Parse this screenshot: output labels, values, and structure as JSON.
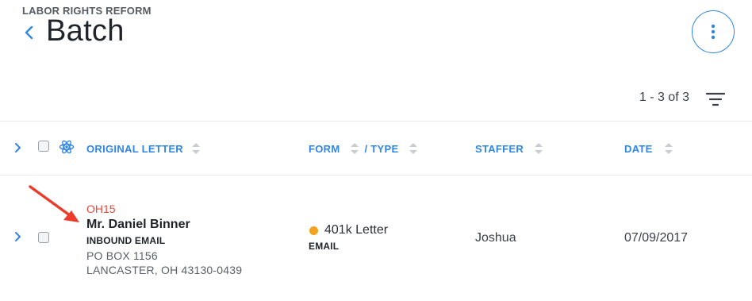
{
  "header": {
    "eyebrow": "LABOR RIGHTS REFORM",
    "title": "Batch"
  },
  "pager": {
    "range": "1 - 3 of 3"
  },
  "columns": {
    "original_letter": "ORIGINAL LETTER",
    "form": "FORM",
    "type": "/ TYPE",
    "staffer": "STAFFER",
    "date": "DATE"
  },
  "rows": [
    {
      "code": "OH15",
      "name": "Mr. Daniel Binner",
      "method": "INBOUND EMAIL",
      "address_line1": "PO BOX 1156",
      "address_line2": "LANCASTER, OH 43130-0439",
      "form_name": "401k Letter",
      "form_type": "EMAIL",
      "staffer": "Joshua",
      "date": "07/09/2017"
    }
  ],
  "colors": {
    "accent": "#2f86e6",
    "code": "#e5483d",
    "status_dot": "#f4a41c",
    "annotation_arrow": "#ec3b2b"
  },
  "icons": [
    "chevron-left-icon",
    "more-vertical-icon",
    "filter-icon",
    "chevron-right-icon",
    "atom-icon",
    "sort-icon",
    "arrow-annotation"
  ]
}
